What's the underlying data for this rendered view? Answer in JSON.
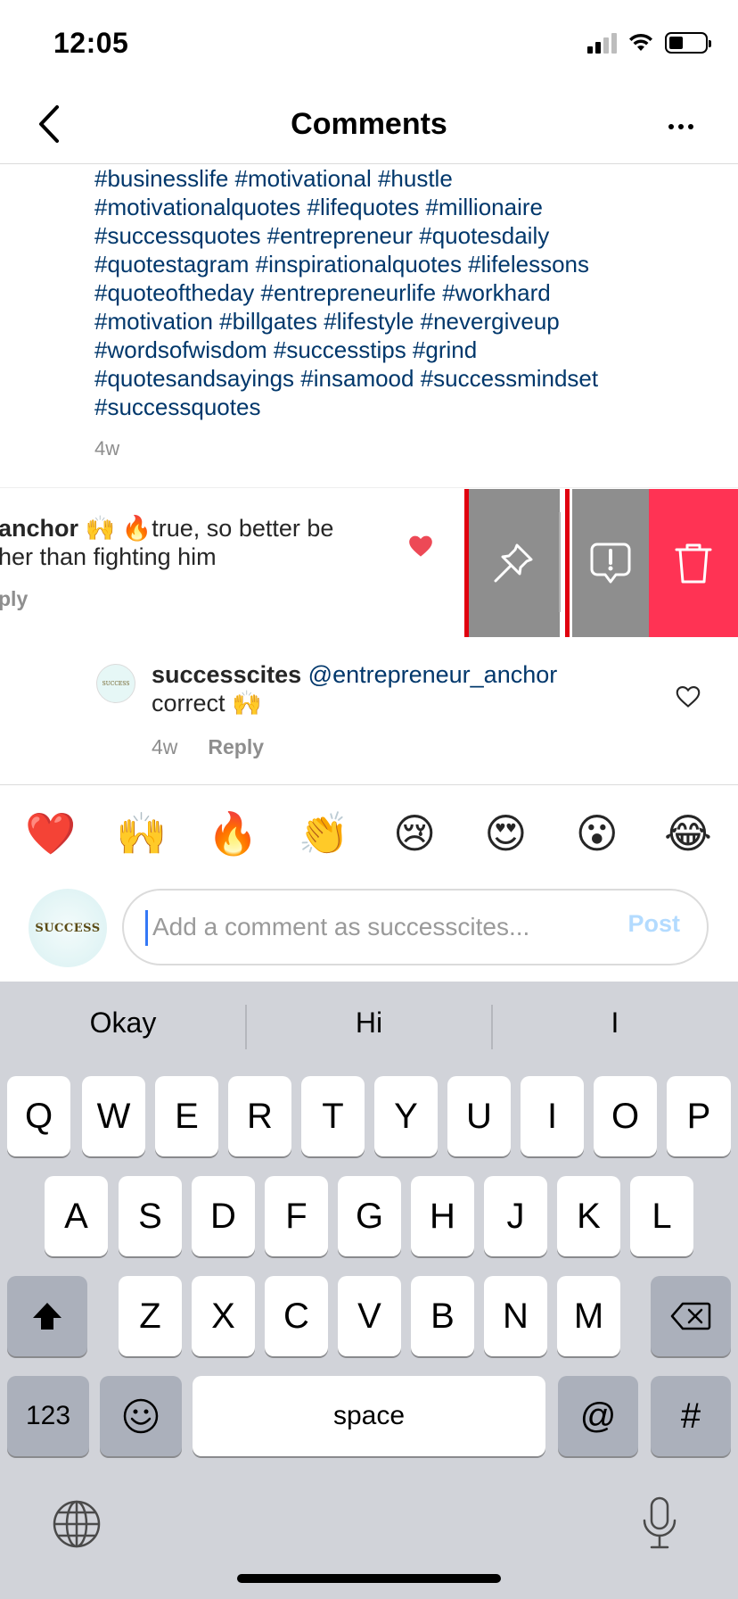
{
  "status_bar": {
    "time": "12:05"
  },
  "header": {
    "title": "Comments"
  },
  "caption": {
    "lines": [
      "#businesslife #motivational #hustle",
      "#motivationalquotes #lifequotes #millionaire",
      "#successquotes #entrepreneur #quotesdaily",
      "#quotestagram #inspirationalquotes #lifelessons",
      "#quoteoftheday #entrepreneurlife #workhard",
      "#motivation #billgates #lifestyle #nevergiveup",
      "#wordsofwisdom #successtips #grind",
      "#quotesandsayings #insamood #successmindset",
      "#successquotes"
    ],
    "time": "4w"
  },
  "swiped_comment": {
    "username_fragment": "anchor",
    "text_line1": " 🙌 🔥true,  so better be",
    "text_line2": "her than fighting him",
    "reply_fragment": "ply",
    "liked": true
  },
  "swipe_actions": {
    "pin_icon": "pin-icon",
    "report_icon": "report-icon",
    "delete_icon": "trash-icon",
    "delete_color": "#ff3354",
    "action_color": "#8e8e8e",
    "highlight_color": "#e0000f"
  },
  "reply_comment": {
    "avatar_text": "SUCCESS",
    "username": "successcites",
    "mention": "@entrepreneur_anchor",
    "text": "correct 🙌",
    "time": "4w",
    "reply_label": "Reply"
  },
  "emoji_bar": [
    "❤️",
    "🙌",
    "🔥",
    "👏",
    "😢",
    "😍",
    "😮",
    "😂"
  ],
  "comment_input": {
    "avatar_text": "SUCCESS",
    "placeholder": "Add a comment as successcites...",
    "post_label": "Post"
  },
  "keyboard": {
    "suggestions": [
      "Okay",
      "Hi",
      "I"
    ],
    "row1": [
      "Q",
      "W",
      "E",
      "R",
      "T",
      "Y",
      "U",
      "I",
      "O",
      "P"
    ],
    "row2": [
      "A",
      "S",
      "D",
      "F",
      "G",
      "H",
      "J",
      "K",
      "L"
    ],
    "row3": [
      "Z",
      "X",
      "C",
      "V",
      "B",
      "N",
      "M"
    ],
    "numbers_label": "123",
    "space_label": "space",
    "at_label": "@",
    "hash_label": "#"
  }
}
